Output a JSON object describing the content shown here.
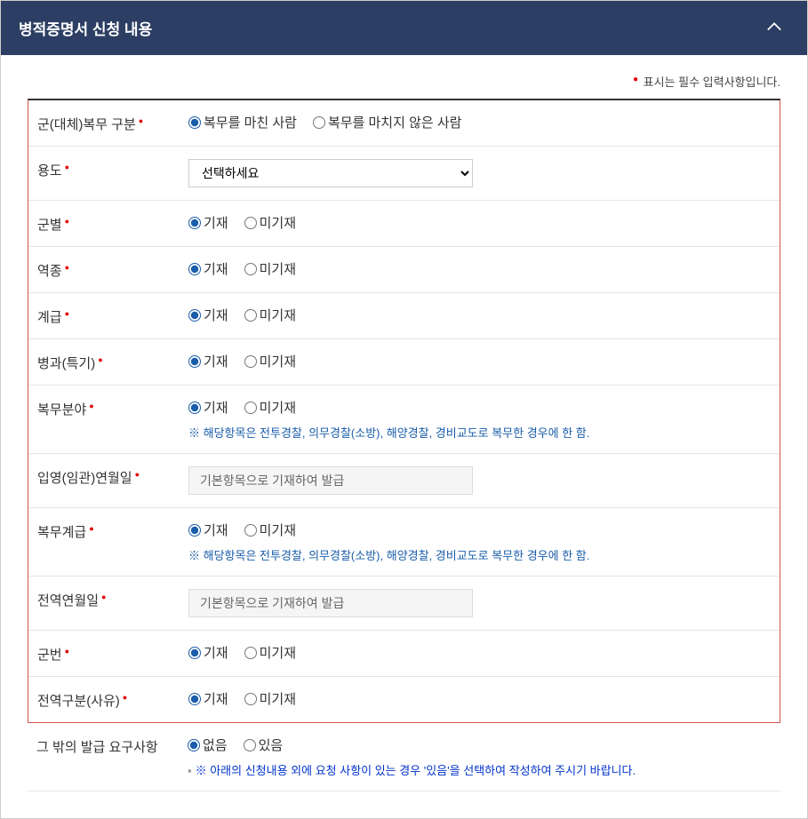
{
  "header": {
    "title": "병적증명서 신청 내용"
  },
  "notice": {
    "text": "표시는 필수 입력사항입니다."
  },
  "options": {
    "write": "기재",
    "no_write": "미기재",
    "none": "없음",
    "exist": "있음"
  },
  "fields": {
    "service_type": {
      "label": "군(대체)복무 구분",
      "opt1": "복무를 마친 사람",
      "opt2": "복무를 마치지 않은 사람"
    },
    "purpose": {
      "label": "용도",
      "placeholder": "선택하세요"
    },
    "branch": {
      "label": "군별"
    },
    "category": {
      "label": "역종"
    },
    "rank": {
      "label": "계급"
    },
    "specialty": {
      "label": "병과(특기)"
    },
    "service_field": {
      "label": "복무분야",
      "note": "※ 해당항목은 전투경찰, 의무경찰(소방), 해양경찰, 경비교도로 복무한 경우에 한 함."
    },
    "enlist_date": {
      "label": "입영(임관)연월일",
      "value": "기본항목으로 기재하여 발급"
    },
    "service_rank": {
      "label": "복무계급",
      "note": "※ 해당항목은 전투경찰, 의무경찰(소방), 해양경찰, 경비교도로 복무한 경우에 한 함."
    },
    "discharge_date": {
      "label": "전역연월일",
      "value": "기본항목으로 기재하여 발급"
    },
    "service_number": {
      "label": "군번"
    },
    "discharge_type": {
      "label": "전역구분(사유)"
    },
    "other_req": {
      "label": "그 밖의 발급 요구사항",
      "note": "※ 아래의 신청내용 외에 요청 사항이 있는 경우 '있음'을 선택하여 작성하여 주시기 바랍니다."
    }
  }
}
